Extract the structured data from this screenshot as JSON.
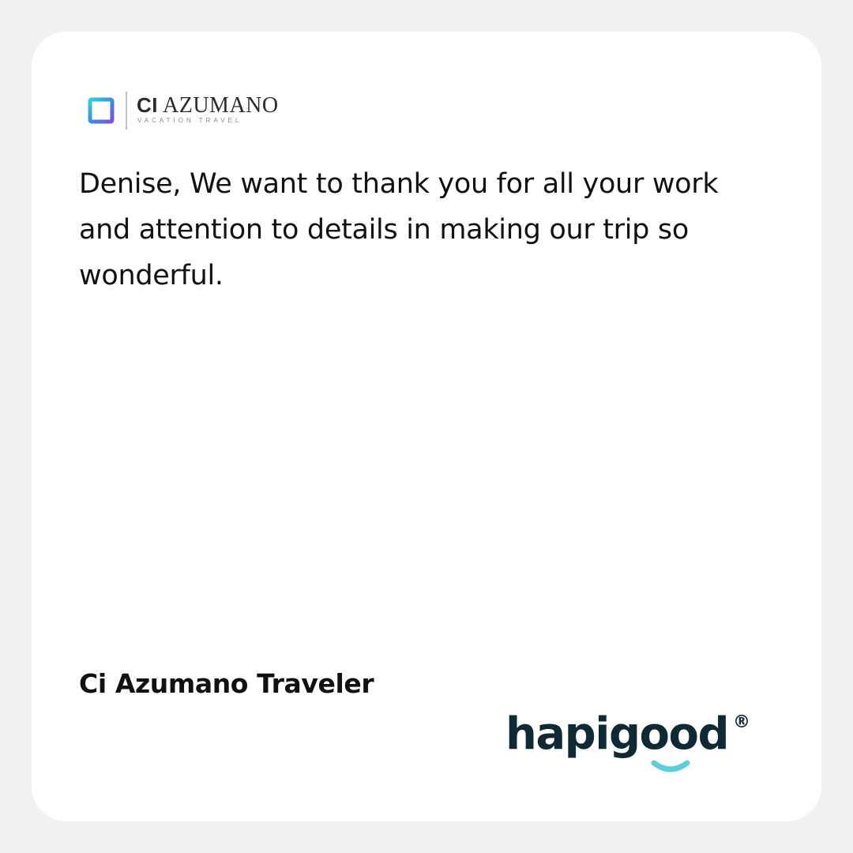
{
  "brand": {
    "ci": "CI",
    "name": "AZUMANO",
    "tagline": "VACATION TRAVEL"
  },
  "testimonial": {
    "quote": "Denise, We want to thank you for all your work and attention to details in making our trip so wonderful.",
    "author": "Ci Azumano Traveler"
  },
  "footer_logo": {
    "word": "hapigood",
    "registered_mark": "®"
  },
  "colors": {
    "page_background": "#f1f2f0",
    "card_background": "#ffffff",
    "text": "#111111",
    "hapigood_text": "#0f2a35",
    "hapigood_smile": "#5ccfdc"
  }
}
